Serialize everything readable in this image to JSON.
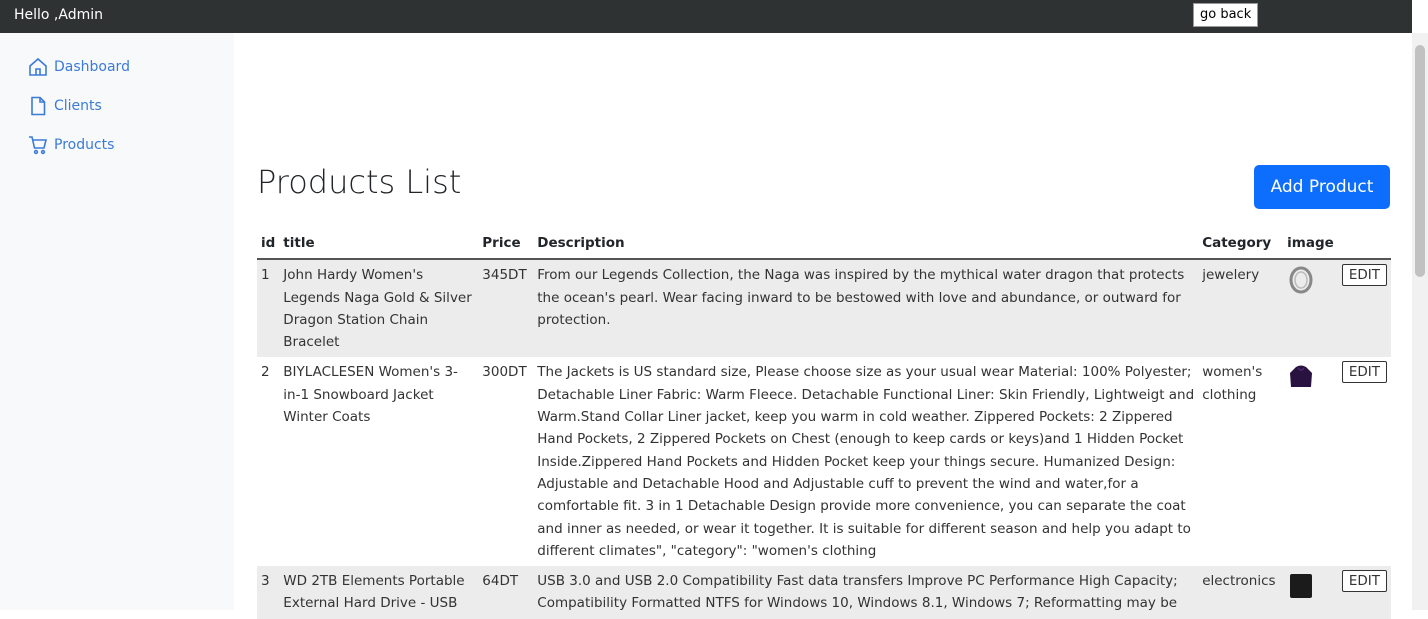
{
  "header": {
    "greeting": "Hello ,Admin",
    "go_back_label": "go back"
  },
  "sidebar": {
    "items": [
      {
        "label": "Dashboard",
        "icon": "home-icon"
      },
      {
        "label": "Clients",
        "icon": "document-icon"
      },
      {
        "label": "Products",
        "icon": "cart-icon"
      }
    ]
  },
  "main": {
    "title": "Products List",
    "add_button_label": "Add Product",
    "table": {
      "columns": [
        "id",
        "title",
        "Price",
        "Description",
        "Category",
        "image",
        ""
      ],
      "rows": [
        {
          "id": "1",
          "title": "John Hardy Women's Legends Naga Gold & Silver Dragon Station Chain Bracelet",
          "price": "345DT",
          "description": "From our Legends Collection, the Naga was inspired by the mythical water dragon that protects the ocean's pearl. Wear facing inward to be bestowed with love and abundance, or outward for protection.",
          "category": "jewelery",
          "image": "bracelet-image",
          "edit_label": "EDIT"
        },
        {
          "id": "2",
          "title": "BIYLACLESEN Women's 3-in-1 Snowboard Jacket Winter Coats",
          "price": "300DT",
          "description": "The Jackets is US standard size, Please choose size as your usual wear Material: 100% Polyester; Detachable Liner Fabric: Warm Fleece. Detachable Functional Liner: Skin Friendly, Lightweigt and Warm.Stand Collar Liner jacket, keep you warm in cold weather. Zippered Pockets: 2 Zippered Hand Pockets, 2 Zippered Pockets on Chest (enough to keep cards or keys)and 1 Hidden Pocket Inside.Zippered Hand Pockets and Hidden Pocket keep your things secure. Humanized Design: Adjustable and Detachable Hood and Adjustable cuff to prevent the wind and water,for a comfortable fit. 3 in 1 Detachable Design provide more convenience, you can separate the coat and inner as needed, or wear it together. It is suitable for different season and help you adapt to different climates\", \"category\": \"women's clothing",
          "category": "women's clothing",
          "image": "jacket-image",
          "edit_label": "EDIT"
        },
        {
          "id": "3",
          "title": "WD 2TB Elements Portable External Hard Drive - USB",
          "price": "64DT",
          "description": "USB 3.0 and USB 2.0 Compatibility Fast data transfers Improve PC Performance High Capacity; Compatibility Formatted NTFS for Windows 10, Windows 8.1, Windows 7; Reformatting may be",
          "category": "electronics",
          "image": "hard-drive-image",
          "edit_label": "EDIT"
        }
      ]
    }
  }
}
